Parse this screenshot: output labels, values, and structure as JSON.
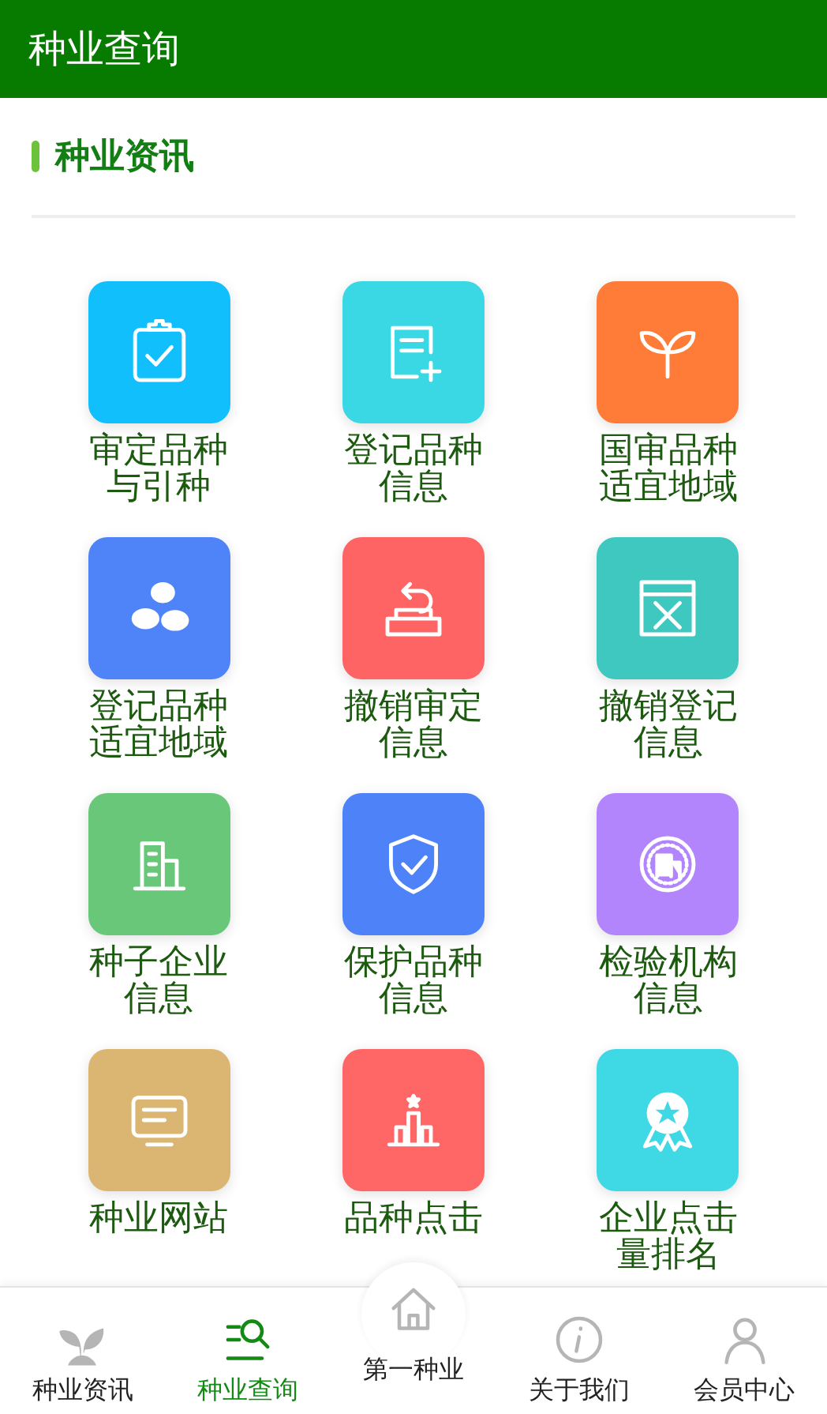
{
  "header": {
    "title": "种业查询"
  },
  "section": {
    "title": "种业资讯"
  },
  "tiles": [
    {
      "label": "审定品种与引种",
      "color": "#10bffb"
    },
    {
      "label": "登记品种信息",
      "color": "#3ad8e4"
    },
    {
      "label": "国审品种适宜地域",
      "color": "#ff7b38"
    },
    {
      "label": "登记品种适宜地域",
      "color": "#4f83f8"
    },
    {
      "label": "撤销审定信息",
      "color": "#ff6464"
    },
    {
      "label": "撤销登记信息",
      "color": "#3ec8bf"
    },
    {
      "label": "种子企业信息",
      "color": "#69c77a"
    },
    {
      "label": "保护品种信息",
      "color": "#4d82f8"
    },
    {
      "label": "检验机构信息",
      "color": "#b385fd"
    },
    {
      "label": "种业网站",
      "color": "#dbb673"
    },
    {
      "label": "品种点击",
      "color": "#ff6666"
    },
    {
      "label": "企业点击量排名",
      "color": "#3fd9e6"
    }
  ],
  "nav": [
    {
      "label": "种业资讯",
      "selected": false
    },
    {
      "label": "种业查询",
      "selected": true
    },
    {
      "label": "第一种业",
      "selected": false,
      "kind": "raised"
    },
    {
      "label": "关于我们",
      "selected": false
    },
    {
      "label": "会员中心",
      "selected": false
    }
  ]
}
